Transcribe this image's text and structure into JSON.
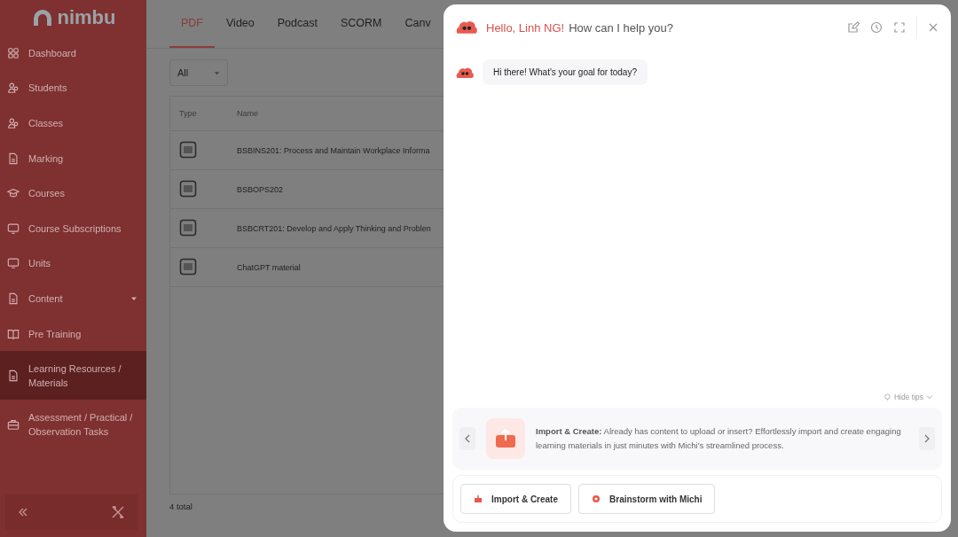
{
  "sidebar": {
    "logo": "nimbu",
    "items": [
      {
        "label": "Dashboard",
        "selected": false,
        "kind": "link"
      },
      {
        "label": "Students",
        "selected": false,
        "kind": "link"
      },
      {
        "label": "Classes",
        "selected": false,
        "kind": "link"
      },
      {
        "label": "Marking",
        "selected": false,
        "kind": "link"
      },
      {
        "label": "Courses",
        "selected": false,
        "kind": "link"
      },
      {
        "label": "Course Subscriptions",
        "selected": false,
        "kind": "link"
      },
      {
        "label": "Units",
        "selected": false,
        "kind": "link"
      },
      {
        "label": "Content",
        "selected": false,
        "kind": "group"
      },
      {
        "label": "Pre Training",
        "selected": false,
        "kind": "link"
      },
      {
        "label": "Learning Resources / Materials",
        "selected": true,
        "kind": "link"
      },
      {
        "label": "Assessment / Practical / Observation Tasks",
        "selected": false,
        "kind": "link"
      }
    ]
  },
  "tabs": [
    {
      "label": "PDF",
      "selected": true
    },
    {
      "label": "Video",
      "selected": false
    },
    {
      "label": "Podcast",
      "selected": false
    },
    {
      "label": "SCORM",
      "selected": false
    },
    {
      "label": "Canv",
      "selected": false
    }
  ],
  "filter": {
    "value": "All"
  },
  "table": {
    "columns": [
      "Type",
      "Name"
    ],
    "rows": [
      {
        "name": "BSBINS201: Process and Maintain Workplace Informa"
      },
      {
        "name": "BSBOPS202"
      },
      {
        "name": "BSBCRT201: Develop and Apply Thinking and Problen"
      },
      {
        "name": "ChatGPT material"
      }
    ]
  },
  "total": "4 total",
  "chat": {
    "greeting": "Hello, Linh NG!",
    "question": "How can I help you?",
    "messages": [
      {
        "text": "Hi there! What's your goal for today?"
      }
    ],
    "hide_tips": "Hide tips",
    "tip": "**Import & Create:** Already has content to upload or insert? Effortlessly import and create engaging learning materials in just minutes with Michi's streamlined process.",
    "actions": [
      {
        "label": "Import & Create",
        "kind": "import"
      },
      {
        "label": "Brainstorm with Michi",
        "kind": "brainstorm"
      }
    ]
  }
}
